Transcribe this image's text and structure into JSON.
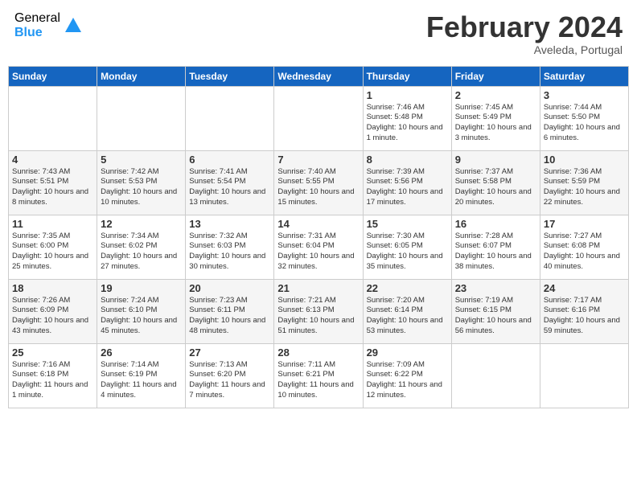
{
  "header": {
    "logo_general": "General",
    "logo_blue": "Blue",
    "month_title": "February 2024",
    "subtitle": "Aveleda, Portugal"
  },
  "calendar": {
    "days_of_week": [
      "Sunday",
      "Monday",
      "Tuesday",
      "Wednesday",
      "Thursday",
      "Friday",
      "Saturday"
    ],
    "weeks": [
      [
        {
          "day": "",
          "info": ""
        },
        {
          "day": "",
          "info": ""
        },
        {
          "day": "",
          "info": ""
        },
        {
          "day": "",
          "info": ""
        },
        {
          "day": "1",
          "info": "Sunrise: 7:46 AM\nSunset: 5:48 PM\nDaylight: 10 hours\nand 1 minute."
        },
        {
          "day": "2",
          "info": "Sunrise: 7:45 AM\nSunset: 5:49 PM\nDaylight: 10 hours\nand 3 minutes."
        },
        {
          "day": "3",
          "info": "Sunrise: 7:44 AM\nSunset: 5:50 PM\nDaylight: 10 hours\nand 6 minutes."
        }
      ],
      [
        {
          "day": "4",
          "info": "Sunrise: 7:43 AM\nSunset: 5:51 PM\nDaylight: 10 hours\nand 8 minutes."
        },
        {
          "day": "5",
          "info": "Sunrise: 7:42 AM\nSunset: 5:53 PM\nDaylight: 10 hours\nand 10 minutes."
        },
        {
          "day": "6",
          "info": "Sunrise: 7:41 AM\nSunset: 5:54 PM\nDaylight: 10 hours\nand 13 minutes."
        },
        {
          "day": "7",
          "info": "Sunrise: 7:40 AM\nSunset: 5:55 PM\nDaylight: 10 hours\nand 15 minutes."
        },
        {
          "day": "8",
          "info": "Sunrise: 7:39 AM\nSunset: 5:56 PM\nDaylight: 10 hours\nand 17 minutes."
        },
        {
          "day": "9",
          "info": "Sunrise: 7:37 AM\nSunset: 5:58 PM\nDaylight: 10 hours\nand 20 minutes."
        },
        {
          "day": "10",
          "info": "Sunrise: 7:36 AM\nSunset: 5:59 PM\nDaylight: 10 hours\nand 22 minutes."
        }
      ],
      [
        {
          "day": "11",
          "info": "Sunrise: 7:35 AM\nSunset: 6:00 PM\nDaylight: 10 hours\nand 25 minutes."
        },
        {
          "day": "12",
          "info": "Sunrise: 7:34 AM\nSunset: 6:02 PM\nDaylight: 10 hours\nand 27 minutes."
        },
        {
          "day": "13",
          "info": "Sunrise: 7:32 AM\nSunset: 6:03 PM\nDaylight: 10 hours\nand 30 minutes."
        },
        {
          "day": "14",
          "info": "Sunrise: 7:31 AM\nSunset: 6:04 PM\nDaylight: 10 hours\nand 32 minutes."
        },
        {
          "day": "15",
          "info": "Sunrise: 7:30 AM\nSunset: 6:05 PM\nDaylight: 10 hours\nand 35 minutes."
        },
        {
          "day": "16",
          "info": "Sunrise: 7:28 AM\nSunset: 6:07 PM\nDaylight: 10 hours\nand 38 minutes."
        },
        {
          "day": "17",
          "info": "Sunrise: 7:27 AM\nSunset: 6:08 PM\nDaylight: 10 hours\nand 40 minutes."
        }
      ],
      [
        {
          "day": "18",
          "info": "Sunrise: 7:26 AM\nSunset: 6:09 PM\nDaylight: 10 hours\nand 43 minutes."
        },
        {
          "day": "19",
          "info": "Sunrise: 7:24 AM\nSunset: 6:10 PM\nDaylight: 10 hours\nand 45 minutes."
        },
        {
          "day": "20",
          "info": "Sunrise: 7:23 AM\nSunset: 6:11 PM\nDaylight: 10 hours\nand 48 minutes."
        },
        {
          "day": "21",
          "info": "Sunrise: 7:21 AM\nSunset: 6:13 PM\nDaylight: 10 hours\nand 51 minutes."
        },
        {
          "day": "22",
          "info": "Sunrise: 7:20 AM\nSunset: 6:14 PM\nDaylight: 10 hours\nand 53 minutes."
        },
        {
          "day": "23",
          "info": "Sunrise: 7:19 AM\nSunset: 6:15 PM\nDaylight: 10 hours\nand 56 minutes."
        },
        {
          "day": "24",
          "info": "Sunrise: 7:17 AM\nSunset: 6:16 PM\nDaylight: 10 hours\nand 59 minutes."
        }
      ],
      [
        {
          "day": "25",
          "info": "Sunrise: 7:16 AM\nSunset: 6:18 PM\nDaylight: 11 hours\nand 1 minute."
        },
        {
          "day": "26",
          "info": "Sunrise: 7:14 AM\nSunset: 6:19 PM\nDaylight: 11 hours\nand 4 minutes."
        },
        {
          "day": "27",
          "info": "Sunrise: 7:13 AM\nSunset: 6:20 PM\nDaylight: 11 hours\nand 7 minutes."
        },
        {
          "day": "28",
          "info": "Sunrise: 7:11 AM\nSunset: 6:21 PM\nDaylight: 11 hours\nand 10 minutes."
        },
        {
          "day": "29",
          "info": "Sunrise: 7:09 AM\nSunset: 6:22 PM\nDaylight: 11 hours\nand 12 minutes."
        },
        {
          "day": "",
          "info": ""
        },
        {
          "day": "",
          "info": ""
        }
      ]
    ]
  }
}
